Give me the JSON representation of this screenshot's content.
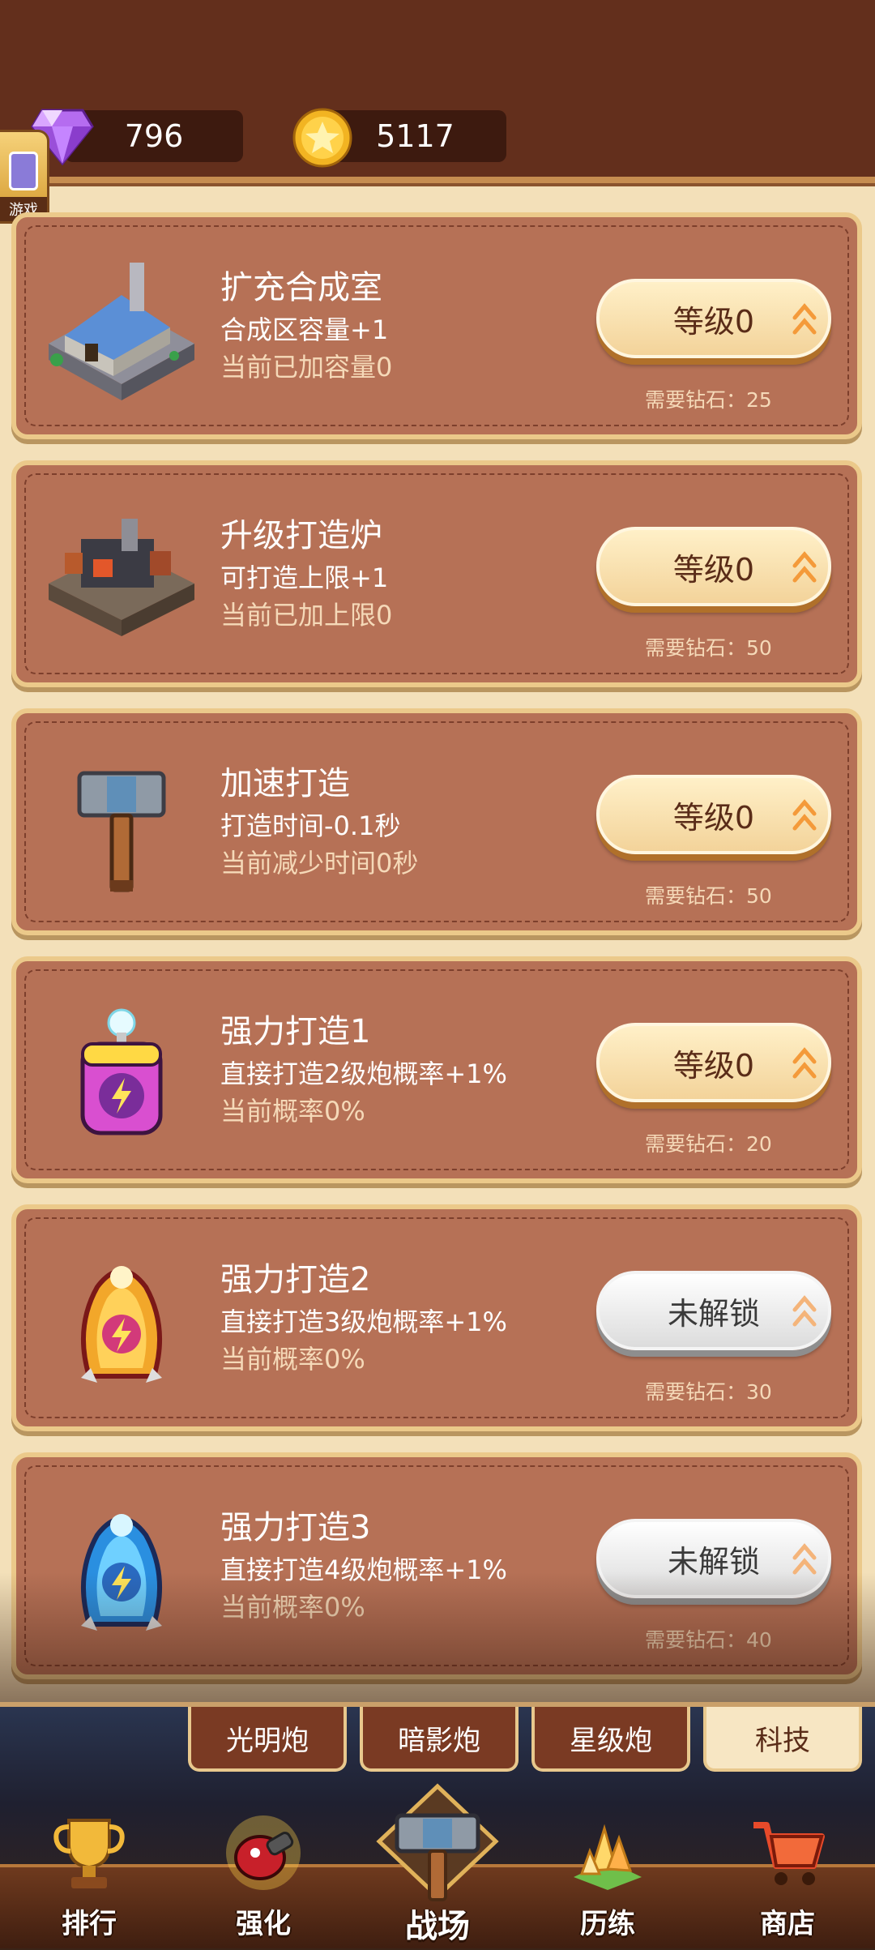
{
  "resources": {
    "gems": "796",
    "coins": "5117"
  },
  "side_widget": {
    "label": "游戏"
  },
  "upgrades": [
    {
      "title": "扩充合成室",
      "desc": "合成区容量+1",
      "current": "当前已加容量0",
      "button": "等级0",
      "cost": "需要钻石：25",
      "locked": false,
      "icon": "workshop-building-icon"
    },
    {
      "title": "升级打造炉",
      "desc": "可打造上限+1",
      "current": "当前已加上限0",
      "button": "等级0",
      "cost": "需要钻石：50",
      "locked": false,
      "icon": "forge-furnace-icon"
    },
    {
      "title": "加速打造",
      "desc": "打造时间-0.1秒",
      "current": "当前减少时间0秒",
      "button": "等级0",
      "cost": "需要钻石：50",
      "locked": false,
      "icon": "hammer-icon"
    },
    {
      "title": "强力打造1",
      "desc": "直接打造2级炮概率+1%",
      "current": "当前概率0%",
      "button": "等级0",
      "cost": "需要钻石：20",
      "locked": false,
      "icon": "pink-energy-jar-icon"
    },
    {
      "title": "强力打造2",
      "desc": "直接打造3级炮概率+1%",
      "current": "当前概率0%",
      "button": "未解锁",
      "cost": "需要钻石：30",
      "locked": true,
      "icon": "gold-energy-capsule-icon"
    },
    {
      "title": "强力打造3",
      "desc": "直接打造4级炮概率+1%",
      "current": "当前概率0%",
      "button": "未解锁",
      "cost": "需要钻石：40",
      "locked": true,
      "icon": "blue-energy-capsule-icon"
    }
  ],
  "subtabs": [
    "光明炮",
    "暗影炮",
    "星级炮",
    "科技"
  ],
  "nav": {
    "rank": "排行",
    "enhance": "强化",
    "battle": "战场",
    "train": "历练",
    "shop": "商店"
  },
  "colors": {
    "top_bar": "#632f1c",
    "card_bg": "#b67156",
    "card_border": "#ebc98a",
    "button_active": "#f3d39a",
    "button_locked": "#dcdcdc"
  }
}
